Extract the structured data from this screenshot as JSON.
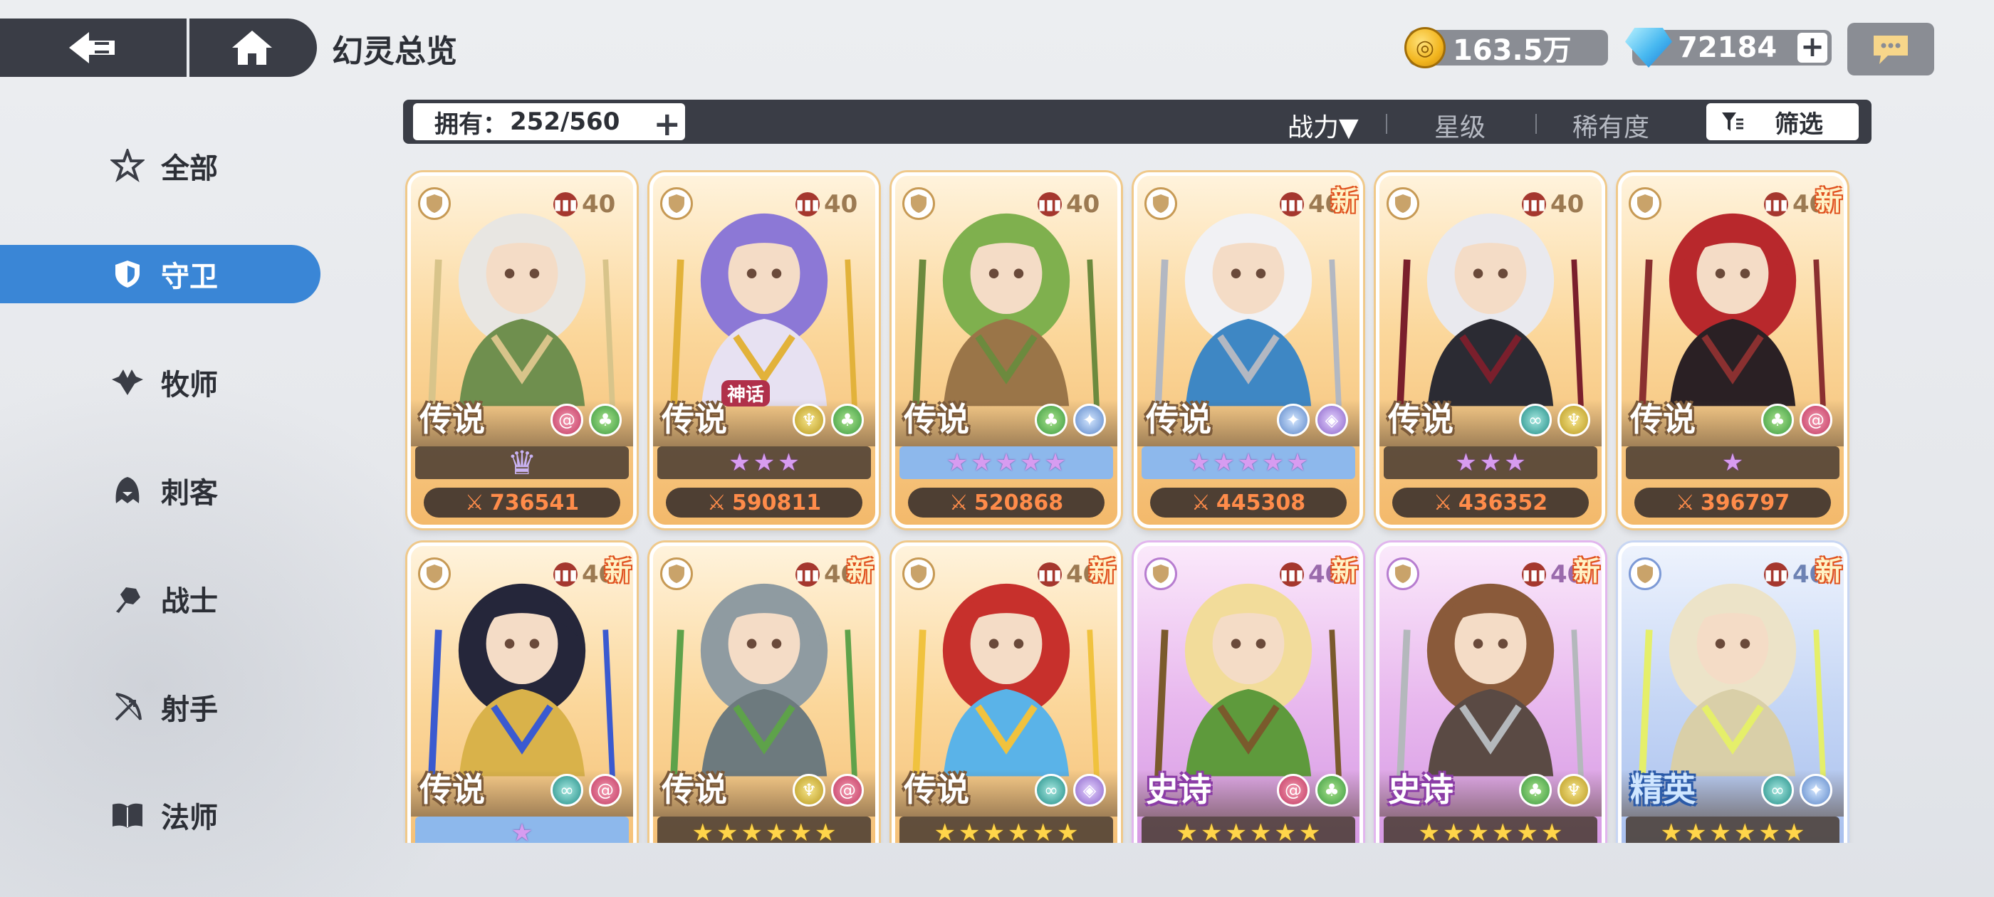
{
  "header": {
    "title": "幻灵总览",
    "gold": "163.5万",
    "gems": "72184",
    "plus": "+"
  },
  "filter_bar": {
    "owned_label": "拥有：",
    "owned_value": "252/560",
    "sort_power": "战力▼",
    "sort_star": "星级",
    "sort_rarity": "稀有度",
    "filter_label": "筛选",
    "separator": "|"
  },
  "sidebar": {
    "items": [
      {
        "label": "全部",
        "icon": "all-star-icon"
      },
      {
        "label": "守卫",
        "icon": "shield-icon"
      },
      {
        "label": "牧师",
        "icon": "wings-icon"
      },
      {
        "label": "刺客",
        "icon": "hood-icon"
      },
      {
        "label": "战士",
        "icon": "fist-icon"
      },
      {
        "label": "射手",
        "icon": "bow-icon"
      },
      {
        "label": "法师",
        "icon": "book-icon"
      }
    ],
    "active_index": 1
  },
  "cards": [
    {
      "rarity": "传说",
      "tier": "legendary",
      "level": "40",
      "new": false,
      "myth": "",
      "elements": [
        "swirl",
        "leaf"
      ],
      "stars": 0,
      "crown": true,
      "star_style": "none",
      "power": "736541"
    },
    {
      "rarity": "传说",
      "tier": "legendary",
      "level": "40",
      "new": false,
      "myth": "神话",
      "elements": [
        "gold",
        "leaf"
      ],
      "stars": 3,
      "crown": false,
      "star_style": "purple",
      "power": "590811"
    },
    {
      "rarity": "传说",
      "tier": "legendary",
      "level": "40",
      "new": false,
      "myth": "",
      "elements": [
        "leaf",
        "star"
      ],
      "stars": 5,
      "crown": false,
      "star_style": "pink-blue",
      "power": "520868"
    },
    {
      "rarity": "传说",
      "tier": "legendary",
      "level": "40",
      "new": true,
      "myth": "",
      "elements": [
        "star",
        "eye"
      ],
      "stars": 5,
      "crown": false,
      "star_style": "purple-blue",
      "power": "445308"
    },
    {
      "rarity": "传说",
      "tier": "legendary",
      "level": "40",
      "new": false,
      "myth": "",
      "elements": [
        "loop",
        "gold"
      ],
      "stars": 3,
      "crown": false,
      "star_style": "purple",
      "power": "436352"
    },
    {
      "rarity": "传说",
      "tier": "legendary",
      "level": "40",
      "new": true,
      "myth": "",
      "elements": [
        "leaf",
        "swirl"
      ],
      "stars": 1,
      "crown": false,
      "star_style": "purple",
      "power": "396797"
    },
    {
      "rarity": "传说",
      "tier": "legendary",
      "level": "40",
      "new": true,
      "myth": "",
      "elements": [
        "loop",
        "swirl"
      ],
      "stars": 1,
      "crown": false,
      "star_style": "purple-blue",
      "power": ""
    },
    {
      "rarity": "传说",
      "tier": "legendary",
      "level": "40",
      "new": true,
      "myth": "",
      "elements": [
        "gold",
        "swirl"
      ],
      "stars": 6,
      "crown": false,
      "star_style": "gold",
      "power": ""
    },
    {
      "rarity": "传说",
      "tier": "legendary",
      "level": "40",
      "new": true,
      "myth": "",
      "elements": [
        "loop",
        "eye"
      ],
      "stars": 6,
      "crown": false,
      "star_style": "gold",
      "power": ""
    },
    {
      "rarity": "史诗",
      "tier": "epic",
      "level": "40",
      "new": true,
      "myth": "",
      "elements": [
        "swirl",
        "leaf"
      ],
      "stars": 6,
      "crown": false,
      "star_style": "gold",
      "power": ""
    },
    {
      "rarity": "史诗",
      "tier": "epic",
      "level": "40",
      "new": true,
      "myth": "",
      "elements": [
        "leaf",
        "gold"
      ],
      "stars": 6,
      "crown": false,
      "star_style": "gold",
      "power": ""
    },
    {
      "rarity": "精英",
      "tier": "elite",
      "level": "40",
      "new": true,
      "myth": "",
      "elements": [
        "loop",
        "star"
      ],
      "stars": 6,
      "crown": false,
      "star_style": "gold",
      "power": ""
    }
  ],
  "labels": {
    "new": "新",
    "star_glyph": "★",
    "crown_glyph": "♛",
    "power_glyph": "⚔"
  },
  "colors": {
    "panel_dark": "#3a3d46",
    "active_blue": "#3a86d6",
    "power_orange": "#ff8c4a"
  }
}
